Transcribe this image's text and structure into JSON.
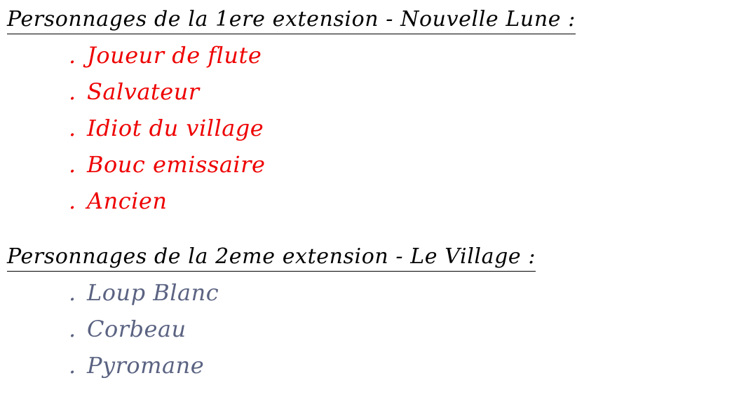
{
  "sections": [
    {
      "title": "Personnages de la 1ere extension - Nouvelle Lune :",
      "color": "#ee0000",
      "items": [
        {
          "bullet": ".",
          "label": "Joueur de flute"
        },
        {
          "bullet": ".",
          "label": "Salvateur"
        },
        {
          "bullet": ".",
          "label": "Idiot du village"
        },
        {
          "bullet": ".",
          "label": "Bouc emissaire"
        },
        {
          "bullet": ".",
          "label": "Ancien"
        }
      ]
    },
    {
      "title": "Personnages de la 2eme extension - Le Village :",
      "color": "#5b6382",
      "items": [
        {
          "bullet": ".",
          "label": "Loup Blanc"
        },
        {
          "bullet": ".",
          "label": "Corbeau"
        },
        {
          "bullet": ".",
          "label": "Pyromane"
        }
      ]
    }
  ]
}
